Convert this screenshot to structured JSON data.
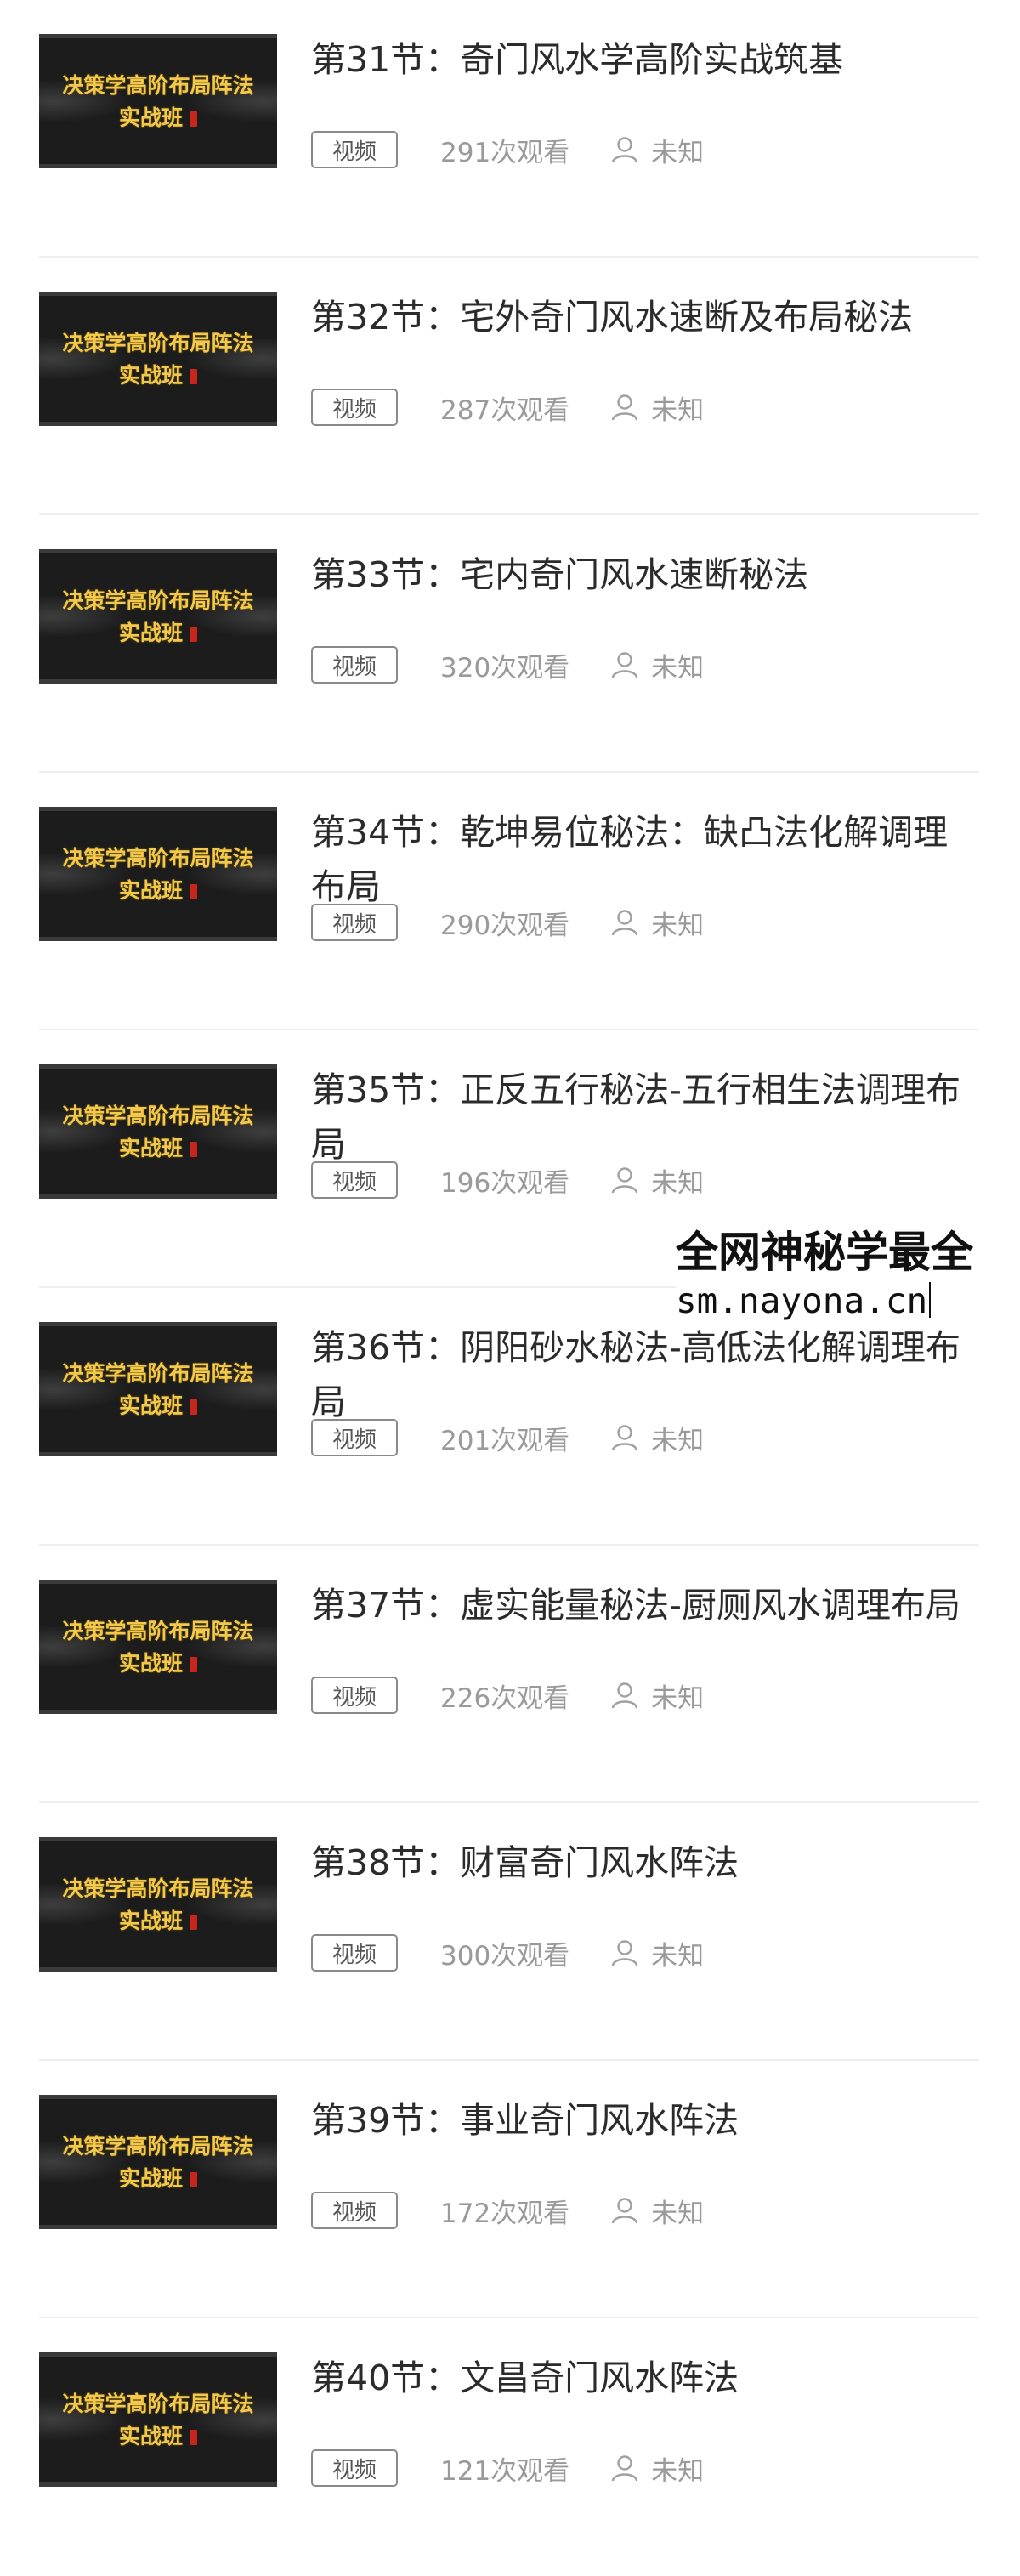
{
  "lessons": [
    {
      "title": "第31节：奇门风水学高阶实战筑基",
      "tag": "视频",
      "views": "291次观看",
      "author": "未知",
      "thumbnail": {
        "line1": "决策学高阶布局阵法",
        "line2": "实战班"
      }
    },
    {
      "title": "第32节：宅外奇门风水速断及布局秘法",
      "tag": "视频",
      "views": "287次观看",
      "author": "未知",
      "thumbnail": {
        "line1": "决策学高阶布局阵法",
        "line2": "实战班"
      }
    },
    {
      "title": "第33节：宅内奇门风水速断秘法",
      "tag": "视频",
      "views": "320次观看",
      "author": "未知",
      "thumbnail": {
        "line1": "决策学高阶布局阵法",
        "line2": "实战班"
      }
    },
    {
      "title": "第34节：乾坤易位秘法：缺凸法化解调理布局",
      "tag": "视频",
      "views": "290次观看",
      "author": "未知",
      "thumbnail": {
        "line1": "决策学高阶布局阵法",
        "line2": "实战班"
      }
    },
    {
      "title": "第35节：正反五行秘法-五行相生法调理布局",
      "tag": "视频",
      "views": "196次观看",
      "author": "未知",
      "thumbnail": {
        "line1": "决策学高阶布局阵法",
        "line2": "实战班"
      }
    },
    {
      "title": "第36节：阴阳砂水秘法-高低法化解调理布局",
      "tag": "视频",
      "views": "201次观看",
      "author": "未知",
      "thumbnail": {
        "line1": "决策学高阶布局阵法",
        "line2": "实战班"
      }
    },
    {
      "title": "第37节：虚实能量秘法-厨厕风水调理布局",
      "tag": "视频",
      "views": "226次观看",
      "author": "未知",
      "thumbnail": {
        "line1": "决策学高阶布局阵法",
        "line2": "实战班"
      }
    },
    {
      "title": "第38节：财富奇门风水阵法",
      "tag": "视频",
      "views": "300次观看",
      "author": "未知",
      "thumbnail": {
        "line1": "决策学高阶布局阵法",
        "line2": "实战班"
      }
    },
    {
      "title": "第39节：事业奇门风水阵法",
      "tag": "视频",
      "views": "172次观看",
      "author": "未知",
      "thumbnail": {
        "line1": "决策学高阶布局阵法",
        "line2": "实战班"
      }
    },
    {
      "title": "第40节：文昌奇门风水阵法",
      "tag": "视频",
      "views": "121次观看",
      "author": "未知",
      "thumbnail": {
        "line1": "决策学高阶布局阵法",
        "line2": "实战班"
      }
    }
  ],
  "watermark": {
    "line1": "全网神秘学最全",
    "line2": "sm.nayona.cn"
  },
  "colors": {
    "title_text": "#2b2b2b",
    "meta_text": "#9a9a9a",
    "thumbnail_text": "#f2c94c",
    "thumbnail_bg": "#1c1c1c",
    "divider": "#eeeeee"
  },
  "icons": {
    "author": "user-icon"
  }
}
